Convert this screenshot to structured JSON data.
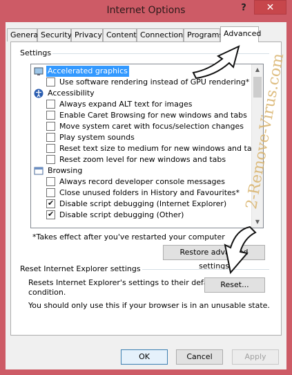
{
  "window": {
    "title": "Internet Options",
    "help_label": "?",
    "close_label": "✕"
  },
  "tabs": [
    {
      "label": "General"
    },
    {
      "label": "Security"
    },
    {
      "label": "Privacy"
    },
    {
      "label": "Content"
    },
    {
      "label": "Connections"
    },
    {
      "label": "Programs"
    },
    {
      "label": "Advanced",
      "active": true
    }
  ],
  "settings": {
    "group_label": "Settings",
    "items": [
      {
        "type": "category",
        "icon": "display-icon",
        "label": "Accelerated graphics",
        "selected": true
      },
      {
        "type": "checkbox",
        "checked": false,
        "label": "Use software rendering instead of GPU rendering*"
      },
      {
        "type": "category",
        "icon": "accessibility-icon",
        "label": "Accessibility"
      },
      {
        "type": "checkbox",
        "checked": false,
        "label": "Always expand ALT text for images"
      },
      {
        "type": "checkbox",
        "checked": false,
        "label": "Enable Caret Browsing for new windows and tabs"
      },
      {
        "type": "checkbox",
        "checked": false,
        "label": "Move system caret with focus/selection changes"
      },
      {
        "type": "checkbox",
        "checked": false,
        "label": "Play system sounds"
      },
      {
        "type": "checkbox",
        "checked": false,
        "label": "Reset text size to medium for new windows and tabs"
      },
      {
        "type": "checkbox",
        "checked": false,
        "label": "Reset zoom level for new windows and tabs"
      },
      {
        "type": "category",
        "icon": "browsing-icon",
        "label": "Browsing"
      },
      {
        "type": "checkbox",
        "checked": false,
        "label": "Always record developer console messages"
      },
      {
        "type": "checkbox",
        "checked": false,
        "label": "Close unused folders in History and Favourites*"
      },
      {
        "type": "checkbox",
        "checked": true,
        "label": "Disable script debugging (Internet Explorer)"
      },
      {
        "type": "checkbox",
        "checked": true,
        "label": "Disable script debugging (Other)"
      }
    ],
    "footnote": "*Takes effect after you've restarted your computer",
    "restore_button": "Restore advanced settings"
  },
  "reset": {
    "group_label": "Reset Internet Explorer settings",
    "description_line1": "Resets Internet Explorer's settings to their default",
    "description_line2": "condition.",
    "reset_button": "Reset...",
    "warning": "You should only use this if your browser is in an unusable state."
  },
  "buttons": {
    "ok": "OK",
    "cancel": "Cancel",
    "apply": "Apply"
  },
  "watermark": "2-Remove-Virus.com",
  "colors": {
    "title_bar": "#cd5b66",
    "selection": "#3399ff",
    "close_button": "#c7464b"
  }
}
